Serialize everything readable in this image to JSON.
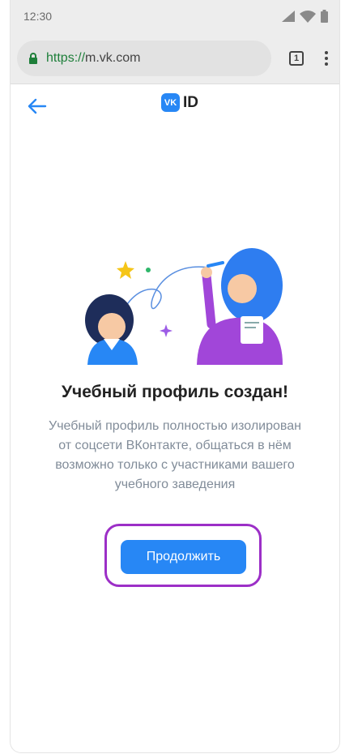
{
  "status_bar": {
    "time": "12:30"
  },
  "browser": {
    "url_scheme": "https://",
    "url_host": "m.vk.com",
    "tab_count": "1"
  },
  "header": {
    "logo_badge": "VK",
    "logo_text": "ID"
  },
  "content": {
    "title": "Учебный профиль создан!",
    "description": "Учебный профиль полностью изолирован от соцсети ВКонтакте, общаться в нём возможно только с участниками вашего учебного заведения",
    "continue_label": "Продолжить"
  },
  "colors": {
    "accent": "#2787f5",
    "highlight": "#9c2fc7",
    "secondary_text": "#818c99"
  }
}
